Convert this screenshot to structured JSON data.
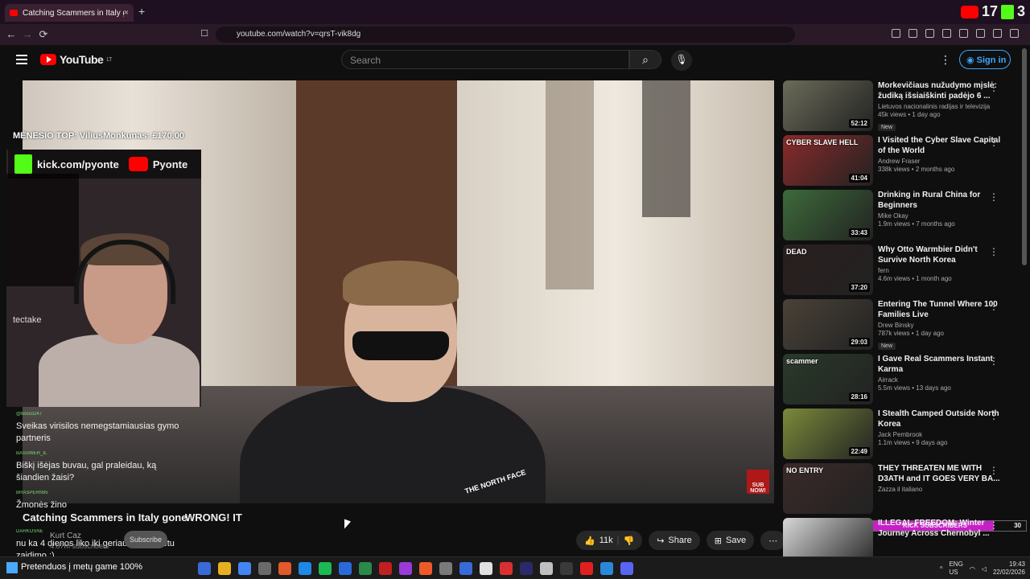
{
  "browser": {
    "tab_title": "Catching Scammers in Italy gone",
    "tab_close": "×",
    "new_tab": "+",
    "url": "youtube.com/watch?v=qrsT-vik8dg",
    "nav_back": "←",
    "nav_forward": "→",
    "nav_reload": "⟳"
  },
  "stream_overlay": {
    "counter_1": "17",
    "counter_2": "3"
  },
  "youtube": {
    "logo": "YouTube",
    "region": "LT",
    "search_placeholder": "Search",
    "search_icon": "search-icon",
    "mic_icon": "mic-icon",
    "more": "⋮",
    "sign_in": "Sign in"
  },
  "stream": {
    "monthly_top": "MĖNESIO TOP: ViliusMonkunas: £170.00",
    "kick_url": "kick.com/pyonte",
    "channel": "Pyonte",
    "sponsor": "tectake",
    "chat": [
      {
        "user": "@bosco247",
        "text": "Sveikas virisilos nemegstamiausias gymo partneris"
      },
      {
        "user": "BASSWER_IL",
        "text": "Biškį išėjas buvau, gal praleidau, ką šiandien žaisi?"
      },
      {
        "user": "BRASPERN95",
        "text": "Žmonės žino"
      },
      {
        "user": "DARKOSNE",
        "text": "nu ka 4 dienos liko iki geriausio siu metu zaidimo :)"
      }
    ],
    "status": "Pretenduos į metų game 100%"
  },
  "video": {
    "title": "Catching Scammers in Italy gone",
    "title_suffix": "WRONG! IT",
    "channel": "Kurt Caz",
    "subscribers": "4.07m subscribers",
    "subscribe": "Subscribe",
    "likes": "11k",
    "share": "Share",
    "save": "Save",
    "more": "⋯",
    "watermark": "SUB NOW!"
  },
  "kick_subscribers": {
    "count": "24",
    "label": "KICK SUBSCRIBERS",
    "goal": "30"
  },
  "recommendations": [
    {
      "title": "Morkevičiaus nužudymo mįslė: žudiką išsiaiškinti padėjo 6 ...",
      "channel": "Lietuvos nacionalinis radijas ir televizija",
      "meta": "45k views • 1 day ago",
      "duration": "52:12",
      "badge": "New",
      "color": "#6b6b5a"
    },
    {
      "title": "I Visited the Cyber Slave Capital of the World",
      "channel": "Andrew Fraser",
      "meta": "338k views • 2 months ago",
      "duration": "41:04",
      "badge": "",
      "color": "#8a2a2a",
      "thumb_label": "CYBER SLAVE HELL"
    },
    {
      "title": "Drinking in Rural China for Beginners",
      "channel": "Mike Okay",
      "meta": "1.9m views • 7 months ago",
      "duration": "33:43",
      "badge": "",
      "color": "#3d6a3a"
    },
    {
      "title": "Why Otto Warmbier Didn't Survive North Korea",
      "channel": "fern",
      "meta": "4.6m views • 1 month ago",
      "duration": "37:20",
      "badge": "",
      "color": "#2a1e1e",
      "thumb_label": "DEAD"
    },
    {
      "title": "Entering The Tunnel Where 100 Families Live",
      "channel": "Drew Binsky",
      "meta": "787k views • 1 day ago",
      "duration": "29:03",
      "badge": "New",
      "color": "#4a4238"
    },
    {
      "title": "I Gave Real Scammers Instant Karma",
      "channel": "Airrack",
      "meta": "5.5m views • 13 days ago",
      "duration": "28:16",
      "badge": "",
      "color": "#2a3a2a",
      "thumb_label": "scammer"
    },
    {
      "title": "I Stealth Camped Outside North Korea",
      "channel": "Jack Pembrook",
      "meta": "1.1m views • 9 days ago",
      "duration": "22:49",
      "badge": "",
      "color": "#7a8a3a"
    },
    {
      "title": "THEY THREATEN ME WITH D3ATH and IT GOES VERY BA...",
      "channel": "Zazza il italiano",
      "meta": "",
      "duration": "",
      "badge": "",
      "color": "#3a2a28",
      "thumb_label": "NO ENTRY"
    },
    {
      "title": "ILLEGAL FREEDOM: Winter Journey Across Chernobyl ...",
      "channel": "",
      "meta": "",
      "duration": "",
      "badge": "",
      "color": "#d8d8d8"
    }
  ],
  "taskbar": {
    "lang": "ENG",
    "region": "US",
    "time": "19:43",
    "date": "22/02/2026",
    "icon_colors": [
      "#3a6ad8",
      "#e8b020",
      "#4285f4",
      "#6a6a6a",
      "#e05a2a",
      "#1e88e5",
      "#1db954",
      "#2a6ad8",
      "#2a8a4a",
      "#c02020",
      "#9a3ad8",
      "#f05a28",
      "#7a7a7a",
      "#3a6ad8",
      "#e0e0e0",
      "#d83030",
      "#2a2a6a",
      "#c0c0c0",
      "#3a3a3a",
      "#e02020",
      "#2a88d8",
      "#5865f2"
    ]
  }
}
